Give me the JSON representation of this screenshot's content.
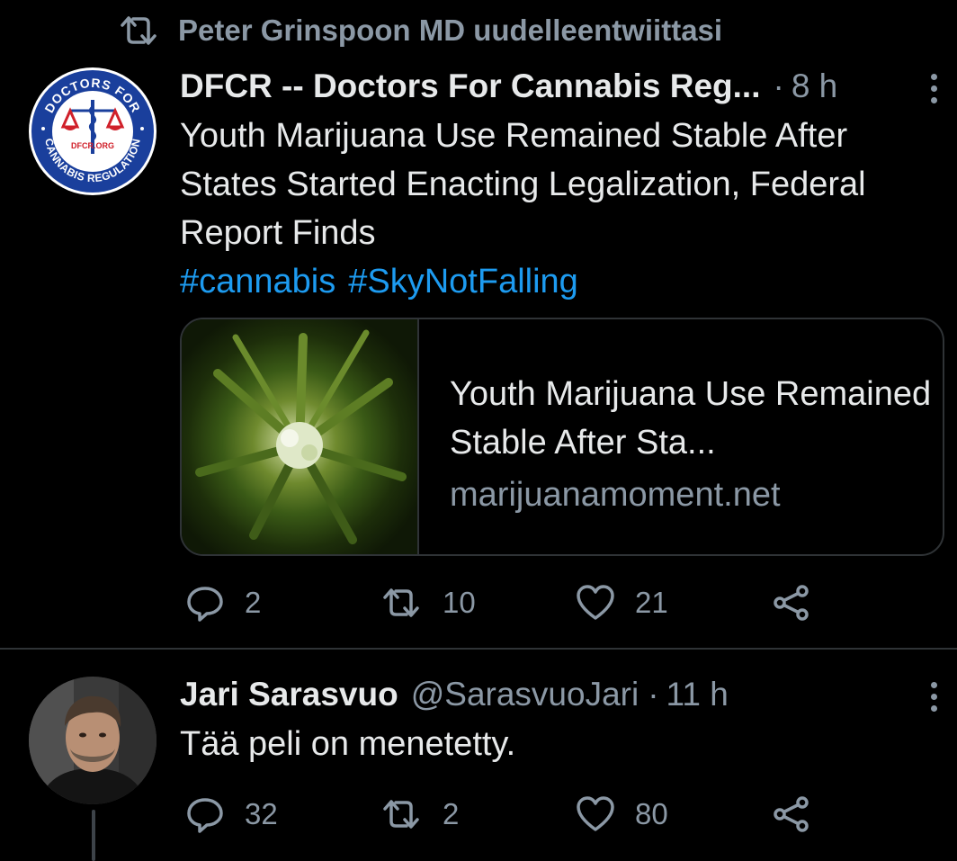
{
  "retweet_context": {
    "icon": "retweet-icon",
    "text": "Peter Grinspoon MD uudelleentwiittasi"
  },
  "tweet1": {
    "author": "DFCR -- Doctors For Cannabis Reg...",
    "time": "8 h",
    "text": "Youth Marijuana Use Remained Stable After States Started Enacting Legalization, Federal Report Finds",
    "hashtags": [
      "#cannabis",
      "#SkyNotFalling"
    ],
    "avatar_lettering": {
      "top": "DOCTORS FOR",
      "bottom": "CANNABIS REGULATION",
      "center": "DFCR.ORG"
    },
    "card": {
      "title": "Youth Marijuana Use Remained Stable After Sta...",
      "domain": "marijuanamoment.net"
    },
    "stats": {
      "replies": "2",
      "retweets": "10",
      "likes": "21"
    }
  },
  "tweet2": {
    "author": "Jari Sarasvuo",
    "handle": "@SarasvuoJari",
    "time": "11 h",
    "text": "Tää peli on menetetty.",
    "stats": {
      "replies": "32",
      "retweets": "2",
      "likes": "80"
    }
  },
  "colors": {
    "background": "#000000",
    "accent": "#1d9bf0",
    "muted": "#8b98a5",
    "text": "#e7e9ea",
    "border": "#2f3336"
  }
}
